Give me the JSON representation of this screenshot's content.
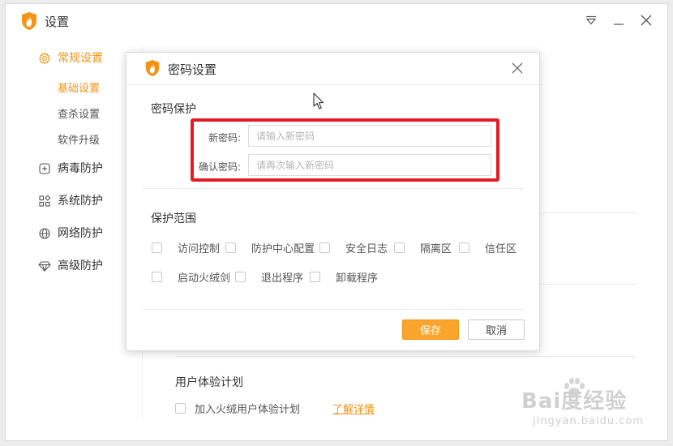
{
  "window": {
    "title": "设置"
  },
  "sidebar": {
    "items": [
      {
        "label": "常规设置",
        "icon": "gear-icon",
        "active": true,
        "children": [
          {
            "label": "基础设置",
            "active": true
          },
          {
            "label": "查杀设置"
          },
          {
            "label": "软件升级"
          }
        ]
      },
      {
        "label": "病毒防护",
        "icon": "plus-square-icon"
      },
      {
        "label": "系统防护",
        "icon": "grid-icon"
      },
      {
        "label": "网络防护",
        "icon": "globe-icon"
      },
      {
        "label": "高级防护",
        "icon": "diamond-icon"
      }
    ]
  },
  "background": {
    "section_title": "用户体验计划",
    "checkbox_label": "加入火绒用户体验计划",
    "link_label": "了解详情"
  },
  "watermark": {
    "text": "Bai度经验",
    "sub": "jingyan.baidu.com"
  },
  "dialog": {
    "title": "密码设置",
    "password_section": "密码保护",
    "new_password_label": "新密码:",
    "new_password_placeholder": "请输入新密码",
    "confirm_password_label": "确认密码:",
    "confirm_password_placeholder": "请再次输入新密码",
    "scope_section": "保护范围",
    "scope_row1": [
      "访问控制",
      "防护中心配置",
      "安全日志",
      "隔离区",
      "信任区"
    ],
    "scope_row2": [
      "启动火绒剑",
      "退出程序",
      "卸载程序"
    ],
    "save_label": "保存",
    "cancel_label": "取消"
  },
  "colors": {
    "accent": "#f29417",
    "save_button": "#f9a42a",
    "highlight_frame": "#e31b23"
  }
}
